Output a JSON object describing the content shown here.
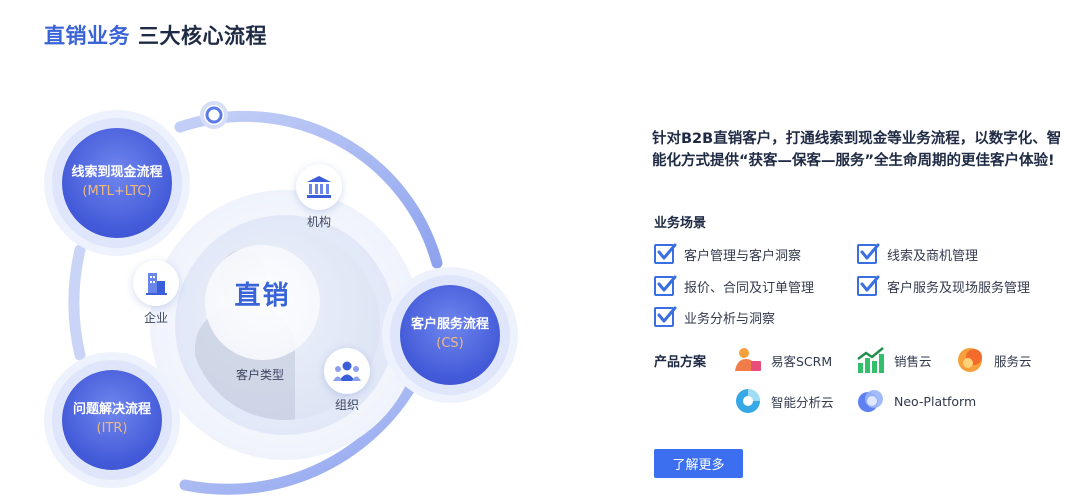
{
  "header": {
    "title_accent": "直销业务",
    "title_rest": "三大核心流程"
  },
  "diagram": {
    "core": "直销",
    "core_caption": "客户类型",
    "nodes": [
      {
        "label": "机构",
        "icon": "institution-icon"
      },
      {
        "label": "企业",
        "icon": "enterprise-icon"
      },
      {
        "label": "组织",
        "icon": "organization-icon"
      }
    ],
    "processes": [
      {
        "title": "线索到现金流程",
        "code": "(MTL+LTC)"
      },
      {
        "title": "客户服务流程",
        "code": "(CS)"
      },
      {
        "title": "问题解决流程",
        "code": "(ITR)"
      }
    ],
    "colors": {
      "accent": "#3a63d8",
      "process": "#4259d8",
      "process_code": "#f0b97e",
      "arc": "#9fb1f0"
    }
  },
  "intro": "针对B2B直销客户，打通线索到现金等业务流程，以数字化、智能化方式提供“获客—保客—服务”全生命周期的更佳客户体验!",
  "scenarios": {
    "title": "业务场景",
    "items": [
      "客户管理与客户洞察",
      "线索及商机管理",
      "报价、合同及订单管理",
      "客户服务及现场服务管理",
      "业务分析与洞察"
    ]
  },
  "products": {
    "title": "产品方案",
    "items": [
      {
        "label": "易客SCRM",
        "icon": "scrm-icon"
      },
      {
        "label": "销售云",
        "icon": "sales-cloud-icon"
      },
      {
        "label": "服务云",
        "icon": "service-cloud-icon"
      },
      {
        "label": "智能分析云",
        "icon": "analytics-cloud-icon"
      },
      {
        "label": "Neo-Platform",
        "icon": "neo-platform-icon"
      }
    ]
  },
  "cta": {
    "label": "了解更多",
    "color": "#3b6ff0"
  }
}
